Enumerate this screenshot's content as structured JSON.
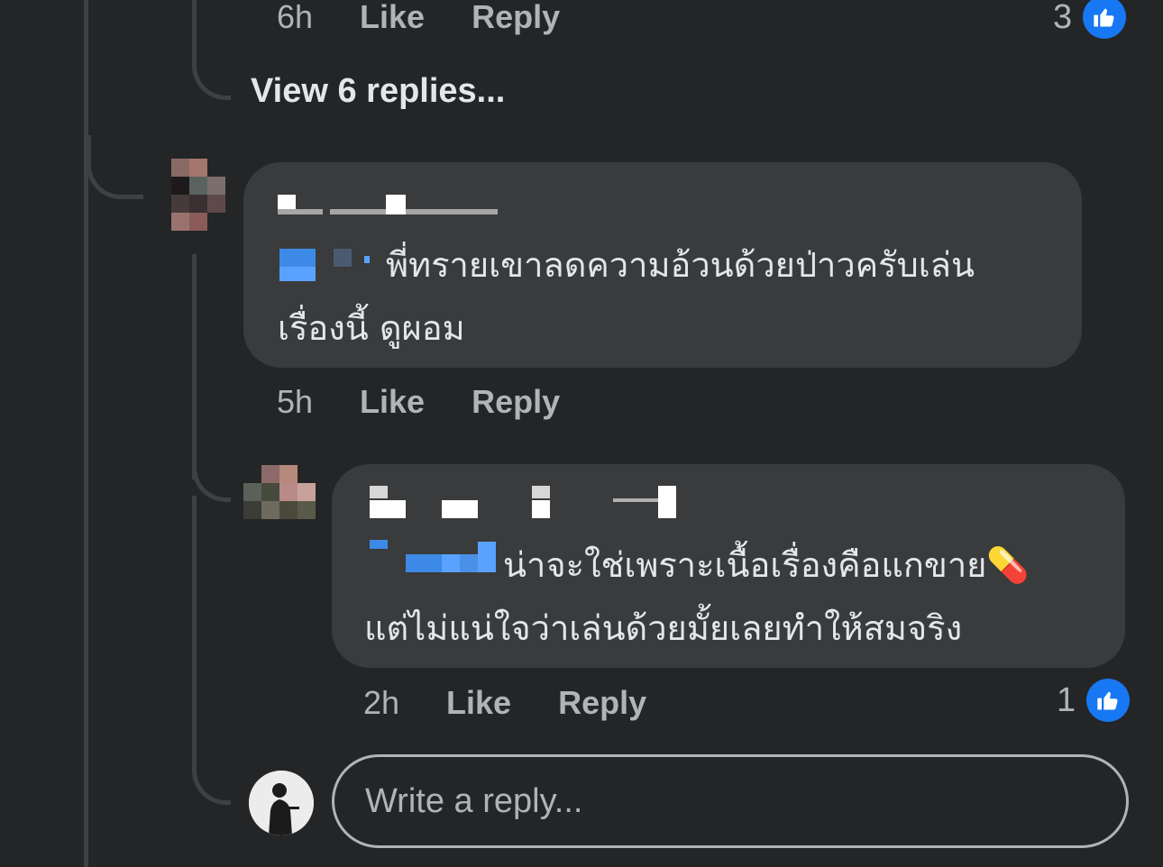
{
  "thread": {
    "top_comment": {
      "time": "6h",
      "like_label": "Like",
      "reply_label": "Reply",
      "reaction_count": "3",
      "reaction_icon": "thumbs-up-icon"
    },
    "view_replies_label": "View 6 replies...",
    "comment_1": {
      "author_name_obscured": true,
      "text_line_1": "พี่ทรายเขาลดความอ้วนด้วยป่าวครับเล่น",
      "text_line_2": "เรื่องนี้ ดูผอม",
      "time": "5h",
      "like_label": "Like",
      "reply_label": "Reply"
    },
    "comment_2": {
      "author_name_obscured": true,
      "text_line_1": "น่าจะใช่เพราะเนื้อเรื่องคือแกขาย💊",
      "text_line_2": "แต่ไม่แน่ใจว่าเล่นด้วยมั้ยเลยทำให้สมจริง",
      "time": "2h",
      "like_label": "Like",
      "reply_label": "Reply",
      "reaction_count": "1",
      "reaction_icon": "thumbs-up-icon"
    },
    "reply_box": {
      "placeholder": "Write a reply..."
    }
  },
  "colors": {
    "background": "#242526",
    "bubble": "#3a3b3c",
    "secondary_text": "#b0b3b8",
    "primary_text": "#e4e6eb",
    "like_blue": "#1877f2",
    "mention_blue": "#4599ff"
  }
}
